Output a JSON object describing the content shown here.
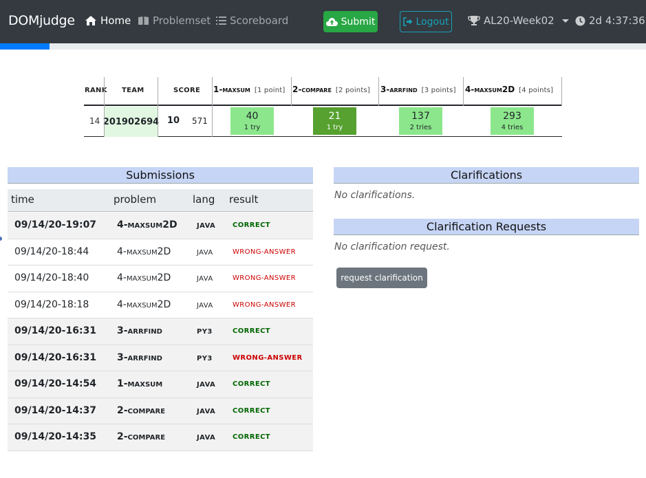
{
  "navbar": {
    "brand": "DOMjudge",
    "home": "Home",
    "problemset": "Problemset",
    "scoreboard": "Scoreboard",
    "submit": "Submit",
    "logout": "Logout",
    "contest": "AL20-Week02",
    "time_left": "2d 4:37:36"
  },
  "scoreboard": {
    "headers": {
      "rank": "RANK",
      "team": "TEAM",
      "score": "SCORE"
    },
    "problems": [
      {
        "name": "1-maxsum",
        "points": "[1 point]"
      },
      {
        "name": "2-compare",
        "points": "[2 points]"
      },
      {
        "name": "3-arrfind",
        "points": "[3 points]"
      },
      {
        "name": "4-maxsum2D",
        "points": "[4 points]"
      }
    ],
    "row": {
      "rank": "14",
      "team": "201902694",
      "score": "10",
      "time": "571",
      "cells": [
        {
          "time": "40",
          "tries": "1 try",
          "first": false
        },
        {
          "time": "21",
          "tries": "1 try",
          "first": true
        },
        {
          "time": "137",
          "tries": "2 tries",
          "first": false
        },
        {
          "time": "293",
          "tries": "4 tries",
          "first": false
        }
      ]
    }
  },
  "submissions": {
    "title": "Submissions",
    "columns": {
      "time": "time",
      "problem": "problem",
      "lang": "lang",
      "result": "result"
    },
    "rows": [
      {
        "time": "09/14/20-19:07",
        "problem": "4-maxsum2D",
        "lang": "java",
        "result": "correct",
        "unread": true
      },
      {
        "time": "09/14/20-18:44",
        "problem": "4-maxsum2D",
        "lang": "java",
        "result": "wrong-answer",
        "unread": false
      },
      {
        "time": "09/14/20-18:40",
        "problem": "4-maxsum2D",
        "lang": "java",
        "result": "wrong-answer",
        "unread": false
      },
      {
        "time": "09/14/20-18:18",
        "problem": "4-maxsum2D",
        "lang": "java",
        "result": "wrong-answer",
        "unread": false
      },
      {
        "time": "09/14/20-16:31",
        "problem": "3-arrfind",
        "lang": "py3",
        "result": "correct",
        "unread": true
      },
      {
        "time": "09/14/20-16:31",
        "problem": "3-arrfind",
        "lang": "py3",
        "result": "wrong-answer",
        "unread": true
      },
      {
        "time": "09/14/20-14:54",
        "problem": "1-maxsum",
        "lang": "java",
        "result": "correct",
        "unread": true
      },
      {
        "time": "09/14/20-14:37",
        "problem": "2-compare",
        "lang": "java",
        "result": "correct",
        "unread": true
      },
      {
        "time": "09/14/20-14:35",
        "problem": "2-compare",
        "lang": "java",
        "result": "correct",
        "unread": true
      }
    ]
  },
  "clarifications": {
    "title": "Clarifications",
    "empty": "No clarifications.",
    "requests_title": "Clarification Requests",
    "requests_empty": "No clarification request.",
    "request_button": "request clarification"
  },
  "colors": {
    "navbar_bg": "#343a40",
    "progress": "#007bff",
    "solved": "#8ce78c",
    "first_solve": "#56a12f",
    "correct": "#006600",
    "wrong": "#cc0000",
    "section_header": "#c6d5f5"
  },
  "contest_progress": 0.077
}
